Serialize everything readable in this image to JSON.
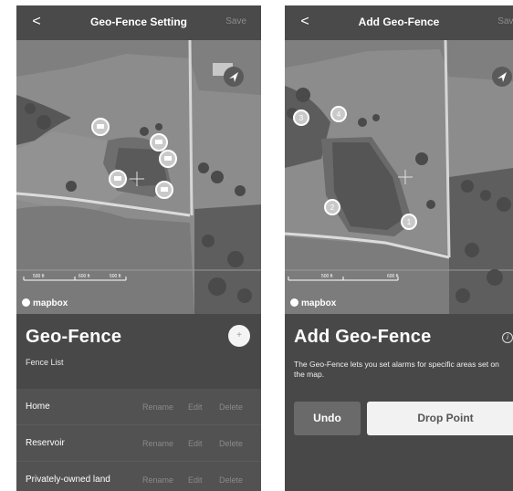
{
  "screen1": {
    "header": {
      "back": "<",
      "title": "Geo-Fence Setting",
      "save": "Save"
    },
    "map": {
      "attribution": "mapbox",
      "scale": [
        "500 ft",
        "600 ft",
        "500 ft"
      ]
    },
    "heading": "Geo-Fence",
    "add_button": "+",
    "subheading": "Fence List",
    "fences": [
      {
        "name": "Home",
        "rename": "Rename",
        "edit": "Edit",
        "delete": "Delete"
      },
      {
        "name": "Reservoir",
        "rename": "Rename",
        "edit": "Edit",
        "delete": "Delete"
      },
      {
        "name": "Privately-owned land",
        "rename": "Rename",
        "edit": "Edit",
        "delete": "Delete"
      }
    ]
  },
  "screen2": {
    "header": {
      "back": "<",
      "title": "Add Geo-Fence",
      "save": "Save"
    },
    "map": {
      "attribution": "mapbox",
      "points": [
        "1",
        "2",
        "3",
        "4"
      ],
      "scale": [
        "500 ft",
        "600 ft"
      ]
    },
    "heading": "Add Geo-Fence",
    "info": "i",
    "description": "The Geo-Fence lets you set alarms for specific areas set on the map.",
    "undo": "Undo",
    "drop_point": "Drop Point"
  },
  "colors": {
    "panel": "#484848",
    "list": "#525252",
    "button_light": "#f2f2f2",
    "button_dark": "#6a6a6a"
  }
}
